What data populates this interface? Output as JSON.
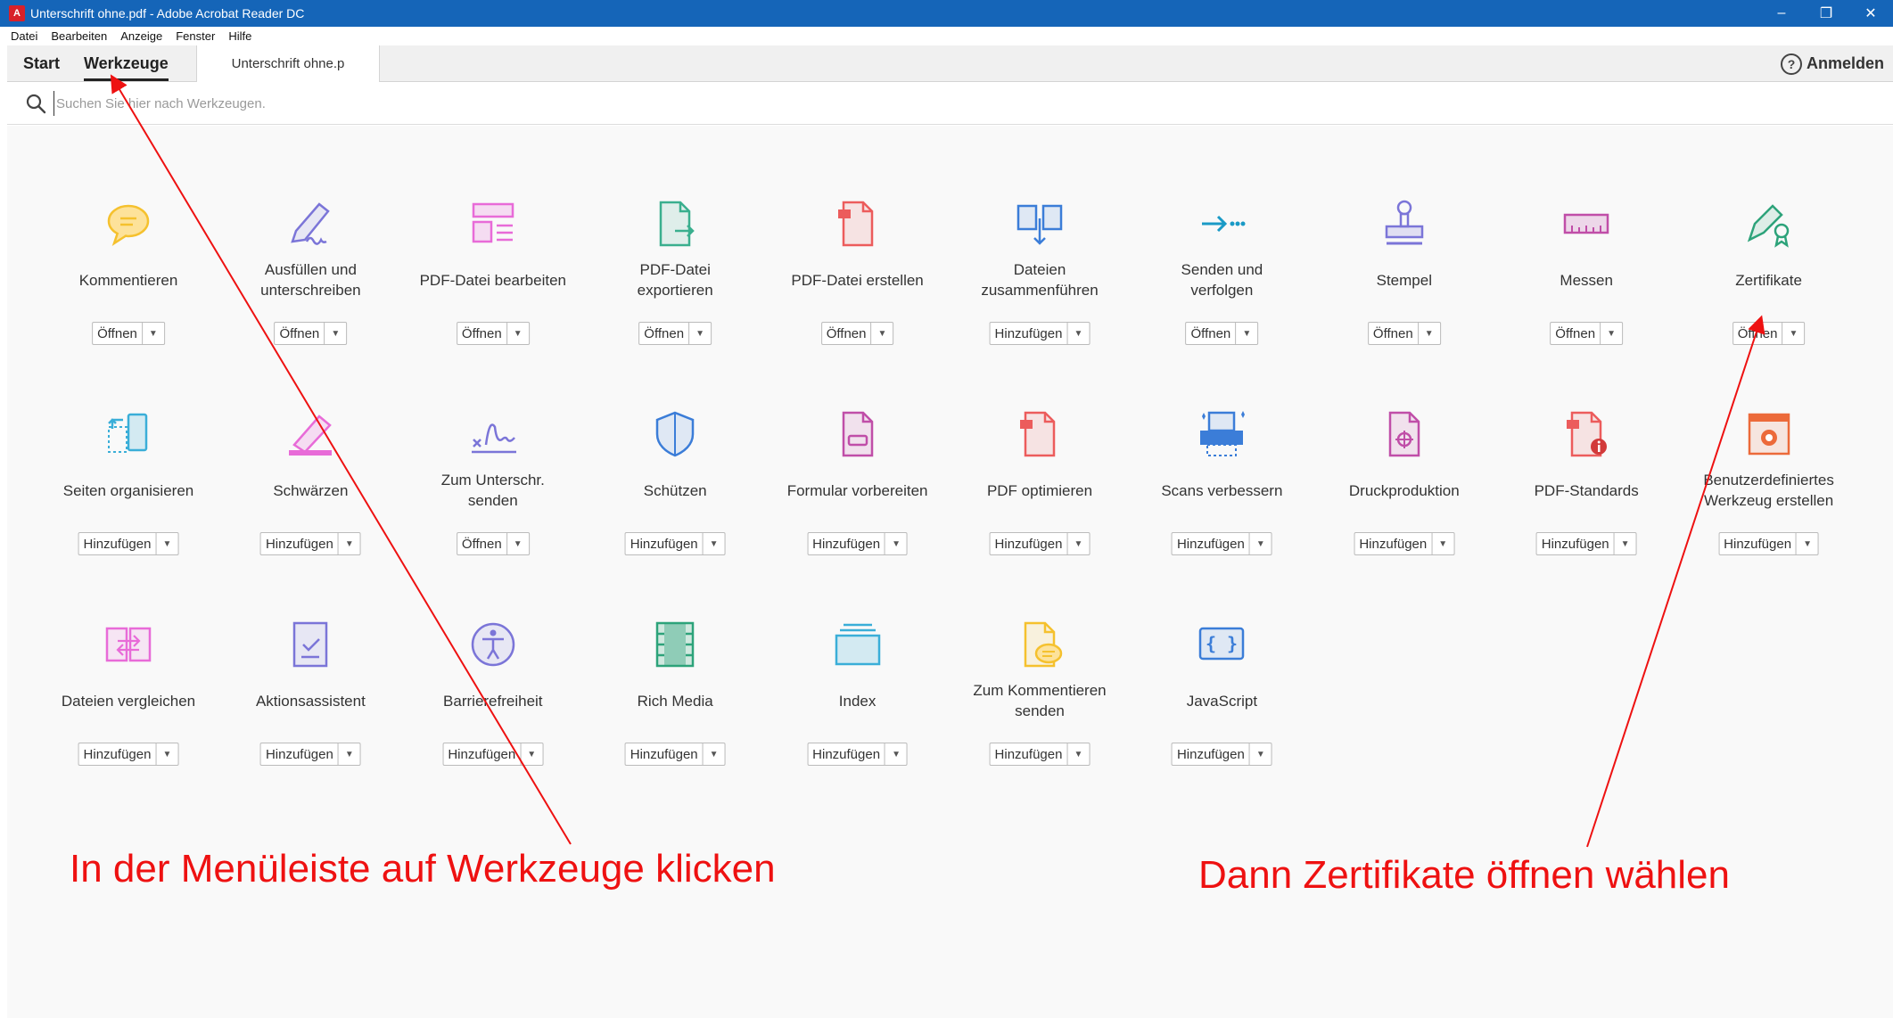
{
  "window": {
    "title": "Unterschrift ohne.pdf - Adobe Acrobat Reader DC",
    "min_glyph": "–",
    "max_glyph": "❐",
    "close_glyph": "✕"
  },
  "menu": [
    "Datei",
    "Bearbeiten",
    "Anzeige",
    "Fenster",
    "Hilfe"
  ],
  "tabs": {
    "start": "Start",
    "werkzeuge": "Werkzeuge",
    "document": "Unterschrift ohne.p",
    "signin": "Anmelden",
    "help": "?"
  },
  "search": {
    "placeholder": "Suchen Sie hier nach Werkzeugen."
  },
  "tools": [
    {
      "label": "Kommentieren",
      "button": "Öffnen",
      "icon": "comment-icon",
      "color": "#f5c12e"
    },
    {
      "label": "Ausfüllen und\nunterschreiben",
      "button": "Öffnen",
      "icon": "fill-sign-icon",
      "color": "#7b75d8"
    },
    {
      "label": "PDF-Datei bearbeiten",
      "button": "Öffnen",
      "icon": "edit-pdf-icon",
      "color": "#e86bd8"
    },
    {
      "label": "PDF-Datei\nexportieren",
      "button": "Öffnen",
      "icon": "export-pdf-icon",
      "color": "#3aaf8e"
    },
    {
      "label": "PDF-Datei erstellen",
      "button": "Öffnen",
      "icon": "create-pdf-icon",
      "color": "#ec5c5c"
    },
    {
      "label": "Dateien\nzusammenführen",
      "button": "Hinzufügen",
      "icon": "combine-files-icon",
      "color": "#3b7dd8"
    },
    {
      "label": "Senden und\nverfolgen",
      "button": "Öffnen",
      "icon": "send-track-icon",
      "color": "#1a9ac6"
    },
    {
      "label": "Stempel",
      "button": "Öffnen",
      "icon": "stamp-icon",
      "color": "#7b75d8"
    },
    {
      "label": "Messen",
      "button": "Öffnen",
      "icon": "measure-icon",
      "color": "#c04ea8"
    },
    {
      "label": "Zertifikate",
      "button": "Öffnen",
      "icon": "certificate-icon",
      "color": "#2da37a"
    },
    {
      "label": "Seiten organisieren",
      "button": "Hinzufügen",
      "icon": "organize-pages-icon",
      "color": "#3aaed8"
    },
    {
      "label": "Schwärzen",
      "button": "Hinzufügen",
      "icon": "redact-icon",
      "color": "#e86bd8"
    },
    {
      "label": "Zum Unterschr.\nsenden",
      "button": "Öffnen",
      "icon": "send-signature-icon",
      "color": "#7b75d8"
    },
    {
      "label": "Schützen",
      "button": "Hinzufügen",
      "icon": "protect-icon",
      "color": "#3b7dd8"
    },
    {
      "label": "Formular vorbereiten",
      "button": "Hinzufügen",
      "icon": "prepare-form-icon",
      "color": "#c04ea8"
    },
    {
      "label": "PDF optimieren",
      "button": "Hinzufügen",
      "icon": "optimize-pdf-icon",
      "color": "#ec5c5c"
    },
    {
      "label": "Scans verbessern",
      "button": "Hinzufügen",
      "icon": "enhance-scans-icon",
      "color": "#3b7dd8"
    },
    {
      "label": "Druckproduktion",
      "button": "Hinzufügen",
      "icon": "print-production-icon",
      "color": "#c04ea8"
    },
    {
      "label": "PDF-Standards",
      "button": "Hinzufügen",
      "icon": "pdf-standards-icon",
      "color": "#ec5c5c"
    },
    {
      "label": "Benutzerdefiniertes\nWerkzeug erstellen",
      "button": "Hinzufügen",
      "icon": "custom-tool-icon",
      "color": "#ec6a3a"
    },
    {
      "label": "Dateien vergleichen",
      "button": "Hinzufügen",
      "icon": "compare-files-icon",
      "color": "#e86bd8"
    },
    {
      "label": "Aktionsassistent",
      "button": "Hinzufügen",
      "icon": "action-wizard-icon",
      "color": "#7b75d8"
    },
    {
      "label": "Barrierefreiheit",
      "button": "Hinzufügen",
      "icon": "accessibility-icon",
      "color": "#7b75d8"
    },
    {
      "label": "Rich Media",
      "button": "Hinzufügen",
      "icon": "rich-media-icon",
      "color": "#2da37a"
    },
    {
      "label": "Index",
      "button": "Hinzufügen",
      "icon": "index-icon",
      "color": "#3aaed8"
    },
    {
      "label": "Zum Kommentieren\nsenden",
      "button": "Hinzufügen",
      "icon": "send-comments-icon",
      "color": "#f5c12e"
    },
    {
      "label": "JavaScript",
      "button": "Hinzufügen",
      "icon": "javascript-icon",
      "color": "#3b7dd8"
    }
  ],
  "annotations": {
    "left": "In der Menüleiste auf Werkzeuge klicken",
    "right": "Dann Zertifikate öffnen wählen",
    "color": "#ee1111"
  }
}
